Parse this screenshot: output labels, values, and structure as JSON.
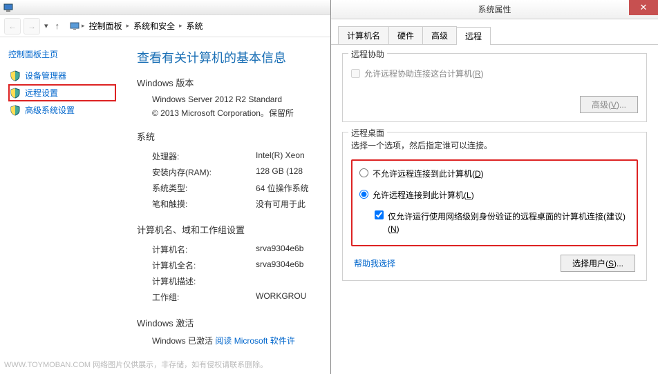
{
  "cp": {
    "breadcrumb": [
      "控制面板",
      "系统和安全",
      "系统"
    ],
    "sidebar": {
      "title": "控制面板主页",
      "items": [
        {
          "label": "设备管理器"
        },
        {
          "label": "远程设置"
        },
        {
          "label": "高级系统设置"
        }
      ]
    },
    "heading": "查看有关计算机的基本信息",
    "winver": {
      "title": "Windows 版本",
      "name": "Windows Server 2012 R2 Standard",
      "copyright": "© 2013 Microsoft Corporation。保留所"
    },
    "system": {
      "title": "系统",
      "rows": [
        {
          "label": "处理器:",
          "value": "Intel(R) Xeon"
        },
        {
          "label": "安装内存(RAM):",
          "value": "128 GB (128"
        },
        {
          "label": "系统类型:",
          "value": "64 位操作系统"
        },
        {
          "label": "笔和触摸:",
          "value": "没有可用于此"
        }
      ]
    },
    "computer": {
      "title": "计算机名、域和工作组设置",
      "rows": [
        {
          "label": "计算机名:",
          "value": "srva9304e6b"
        },
        {
          "label": "计算机全名:",
          "value": "srva9304e6b"
        },
        {
          "label": "计算机描述:",
          "value": ""
        },
        {
          "label": "工作组:",
          "value": "WORKGROU"
        }
      ]
    },
    "activation": {
      "title": "Windows 激活",
      "status_pre": "Windows 已激活 ",
      "link": "阅读 Microsoft 软件许"
    }
  },
  "sp": {
    "title": "系统属性",
    "tabs": [
      "计算机名",
      "硬件",
      "高级",
      "远程"
    ],
    "active_tab": 3,
    "assist": {
      "group_title": "远程协助",
      "checkbox_label": "允许远程协助连接这台计算机(R)",
      "advanced_btn": "高级(V)..."
    },
    "desktop": {
      "group_title": "远程桌面",
      "prompt": "选择一个选项，然后指定谁可以连接。",
      "radio_deny": "不允许远程连接到此计算机(D)",
      "radio_allow": "允许远程连接到此计算机(L)",
      "nla_checkbox": "仅允许运行使用网络级别身份验证的远程桌面的计算机连接(建议)(N)",
      "help_link": "帮助我选择",
      "select_users_btn": "选择用户(S)..."
    }
  },
  "watermark": "WWW.TOYMOBAN.COM  网络图片仅供展示，非存储，如有侵权请联系删除。"
}
